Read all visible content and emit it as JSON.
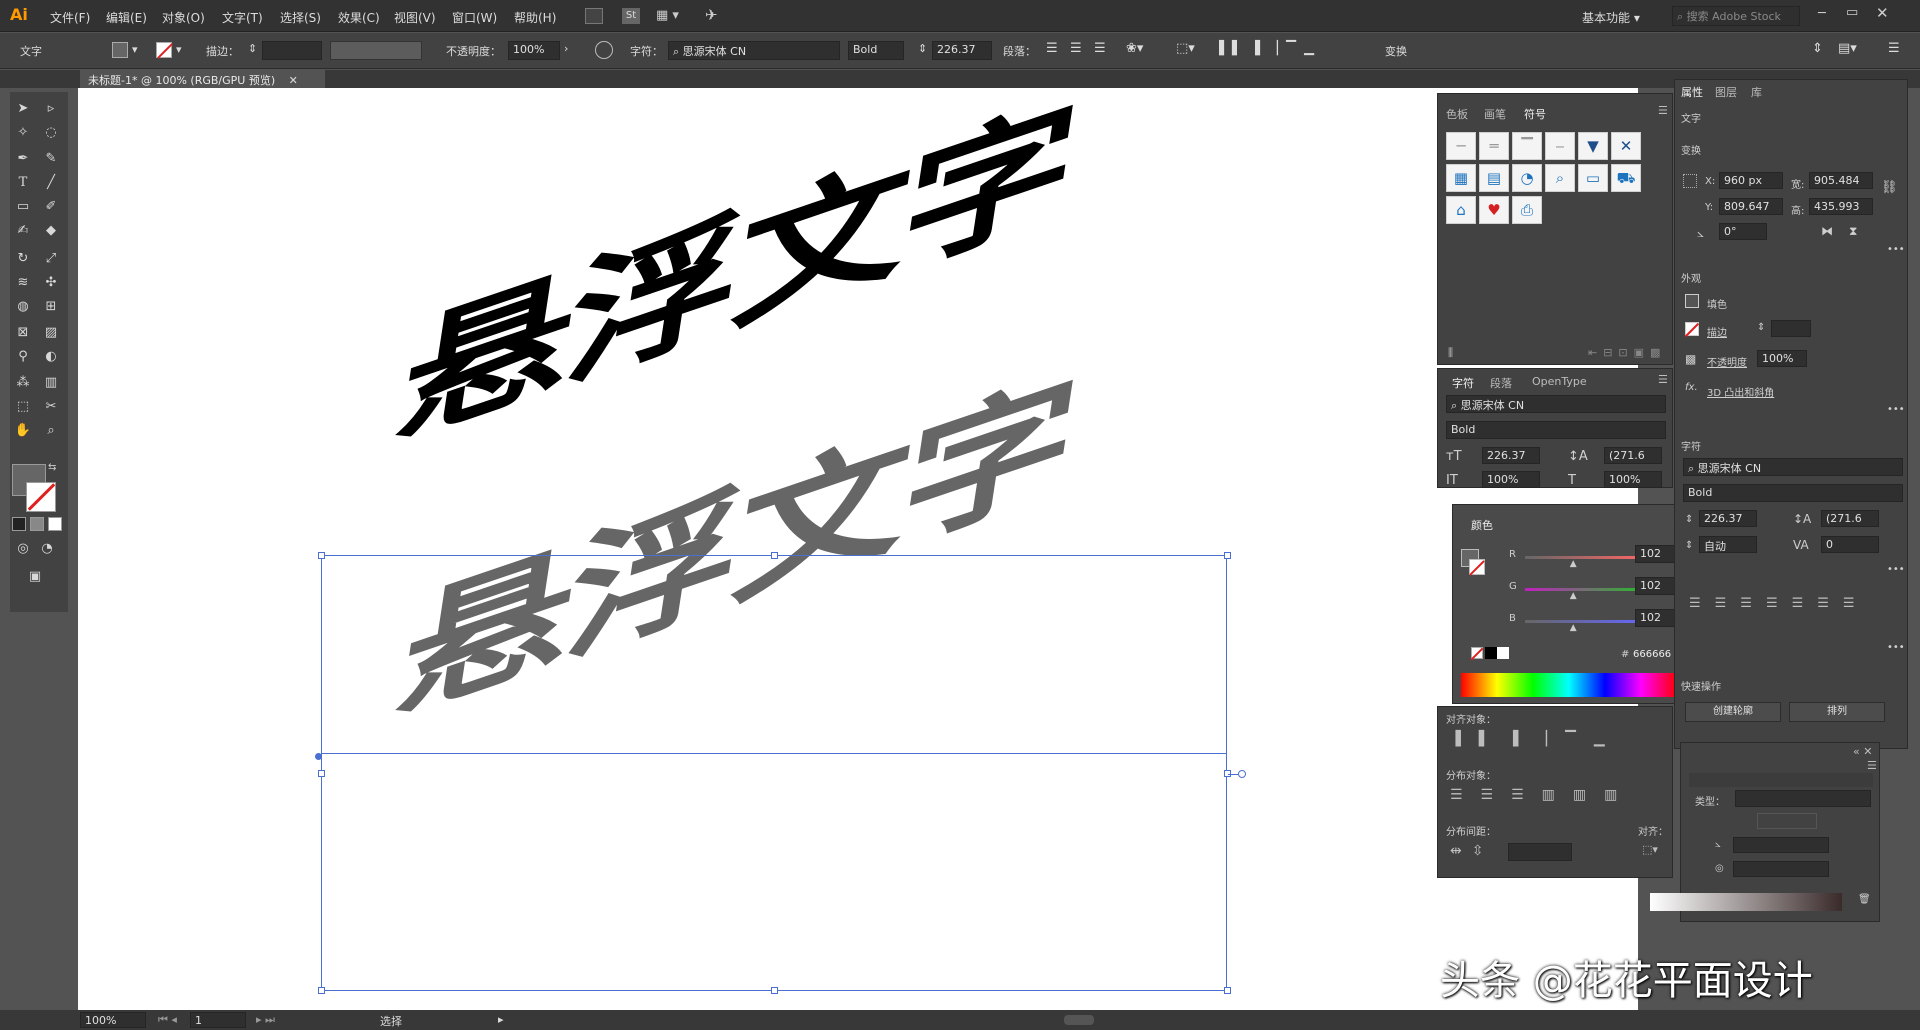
{
  "app": {
    "logo": "Ai"
  },
  "menu": [
    "文件(F)",
    "编辑(E)",
    "对象(O)",
    "文字(T)",
    "选择(S)",
    "效果(C)",
    "视图(V)",
    "窗口(W)",
    "帮助(H)"
  ],
  "menu_right": {
    "workspace": "基本功能",
    "search_placeholder": "搜索 Adobe Stock"
  },
  "control": {
    "mode_label": "文字",
    "stroke_label": "描边：",
    "opacity_label": "不透明度：",
    "opacity_value": "100%",
    "char_label": "字符：",
    "font_name": "思源宋体 CN",
    "font_style": "Bold",
    "font_size": "226.37",
    "para_label": "段落：",
    "transform_label": "变换"
  },
  "document": {
    "tab_title": "未标题-1* @ 100% (RGB/GPU 预览)"
  },
  "artwork": {
    "text_top": "悬浮文字",
    "text_bottom": "悬浮文字",
    "colors": {
      "top": "#000000",
      "bottom": "#666666",
      "selection": "#4a6fd2"
    }
  },
  "status": {
    "zoom": "100%",
    "page": "1",
    "tool": "选择"
  },
  "swatch_panel": {
    "tabs": [
      "色板",
      "画笔",
      "符号"
    ],
    "active": "符号"
  },
  "char_panel": {
    "tabs": [
      "字符",
      "段落",
      "OpenType"
    ],
    "font": "思源宋体 CN",
    "style": "Bold",
    "size": "226.37",
    "leading": "(271.6",
    "vscale": "100%",
    "hscale": "100%"
  },
  "color_panel": {
    "title": "颜色",
    "r_label": "R",
    "r": "102",
    "g_label": "G",
    "g": "102",
    "b_label": "B",
    "b": "102",
    "hex_label": "#",
    "hex": "666666",
    "r_level": 0.4,
    "g_level": 0.4,
    "b_level": 0.4
  },
  "align_panel": {
    "align_label": "对齐对象：",
    "distribute_label": "分布对象：",
    "spacing_label": "分布间距：",
    "align_to_label": "对齐："
  },
  "props_panel": {
    "tabs": [
      "属性",
      "图层",
      "库"
    ],
    "section_type": "文字",
    "section_transform": "变换",
    "x_label": "X:",
    "x": "960 px",
    "y_label": "Y:",
    "y": "809.647",
    "w_label": "宽:",
    "w": "905.484",
    "h_label": "高:",
    "h": "435.993",
    "angle": "0°",
    "section_appearance": "外观",
    "fill_label": "填色",
    "stroke_label": "描边",
    "opacity_label": "不透明度",
    "opacity": "100%",
    "fx_label": "3D 凸出和斜角",
    "section_char": "字符",
    "font": "思源宋体 CN",
    "style": "Bold",
    "size": "226.37",
    "leading": "(271.6",
    "tracking_auto": "自动",
    "kerning": "0",
    "section_quick": "快速操作",
    "btn_outline": "创建轮廓",
    "btn_arrange": "排列",
    "type_label": "类型："
  },
  "watermark": "头条 @花花平面设计"
}
